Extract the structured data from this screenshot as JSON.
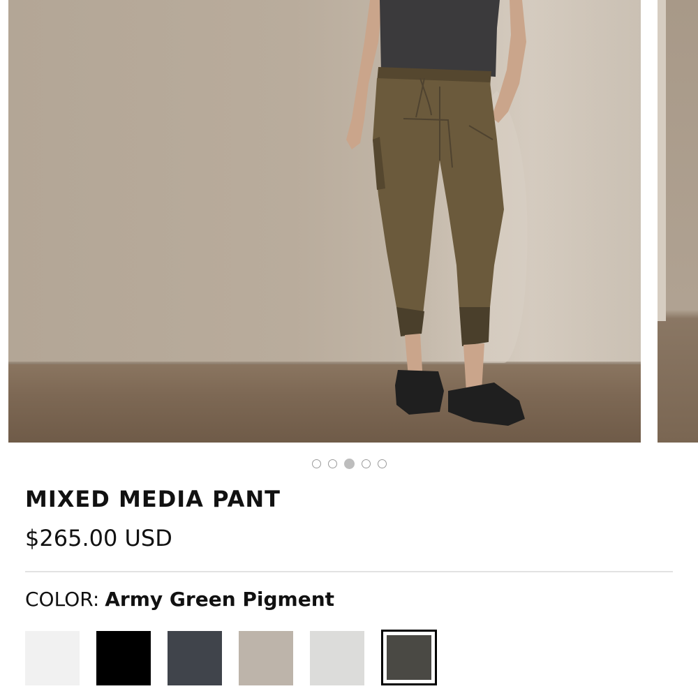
{
  "carousel": {
    "slide_count": 5,
    "active_index": 2
  },
  "product": {
    "title": "MIXED MEDIA PANT",
    "price": "$265.00 USD"
  },
  "color": {
    "label": "COLOR:",
    "selected_name": "Army Green Pigment",
    "swatches": [
      {
        "color": "#f1f1f1",
        "selected": false
      },
      {
        "color": "#000000",
        "selected": false
      },
      {
        "color": "#40444b",
        "selected": false
      },
      {
        "color": "#bdb4aa",
        "selected": false
      },
      {
        "color": "#dcdcda",
        "selected": false
      },
      {
        "color": "#4a4944",
        "selected": true
      }
    ]
  }
}
